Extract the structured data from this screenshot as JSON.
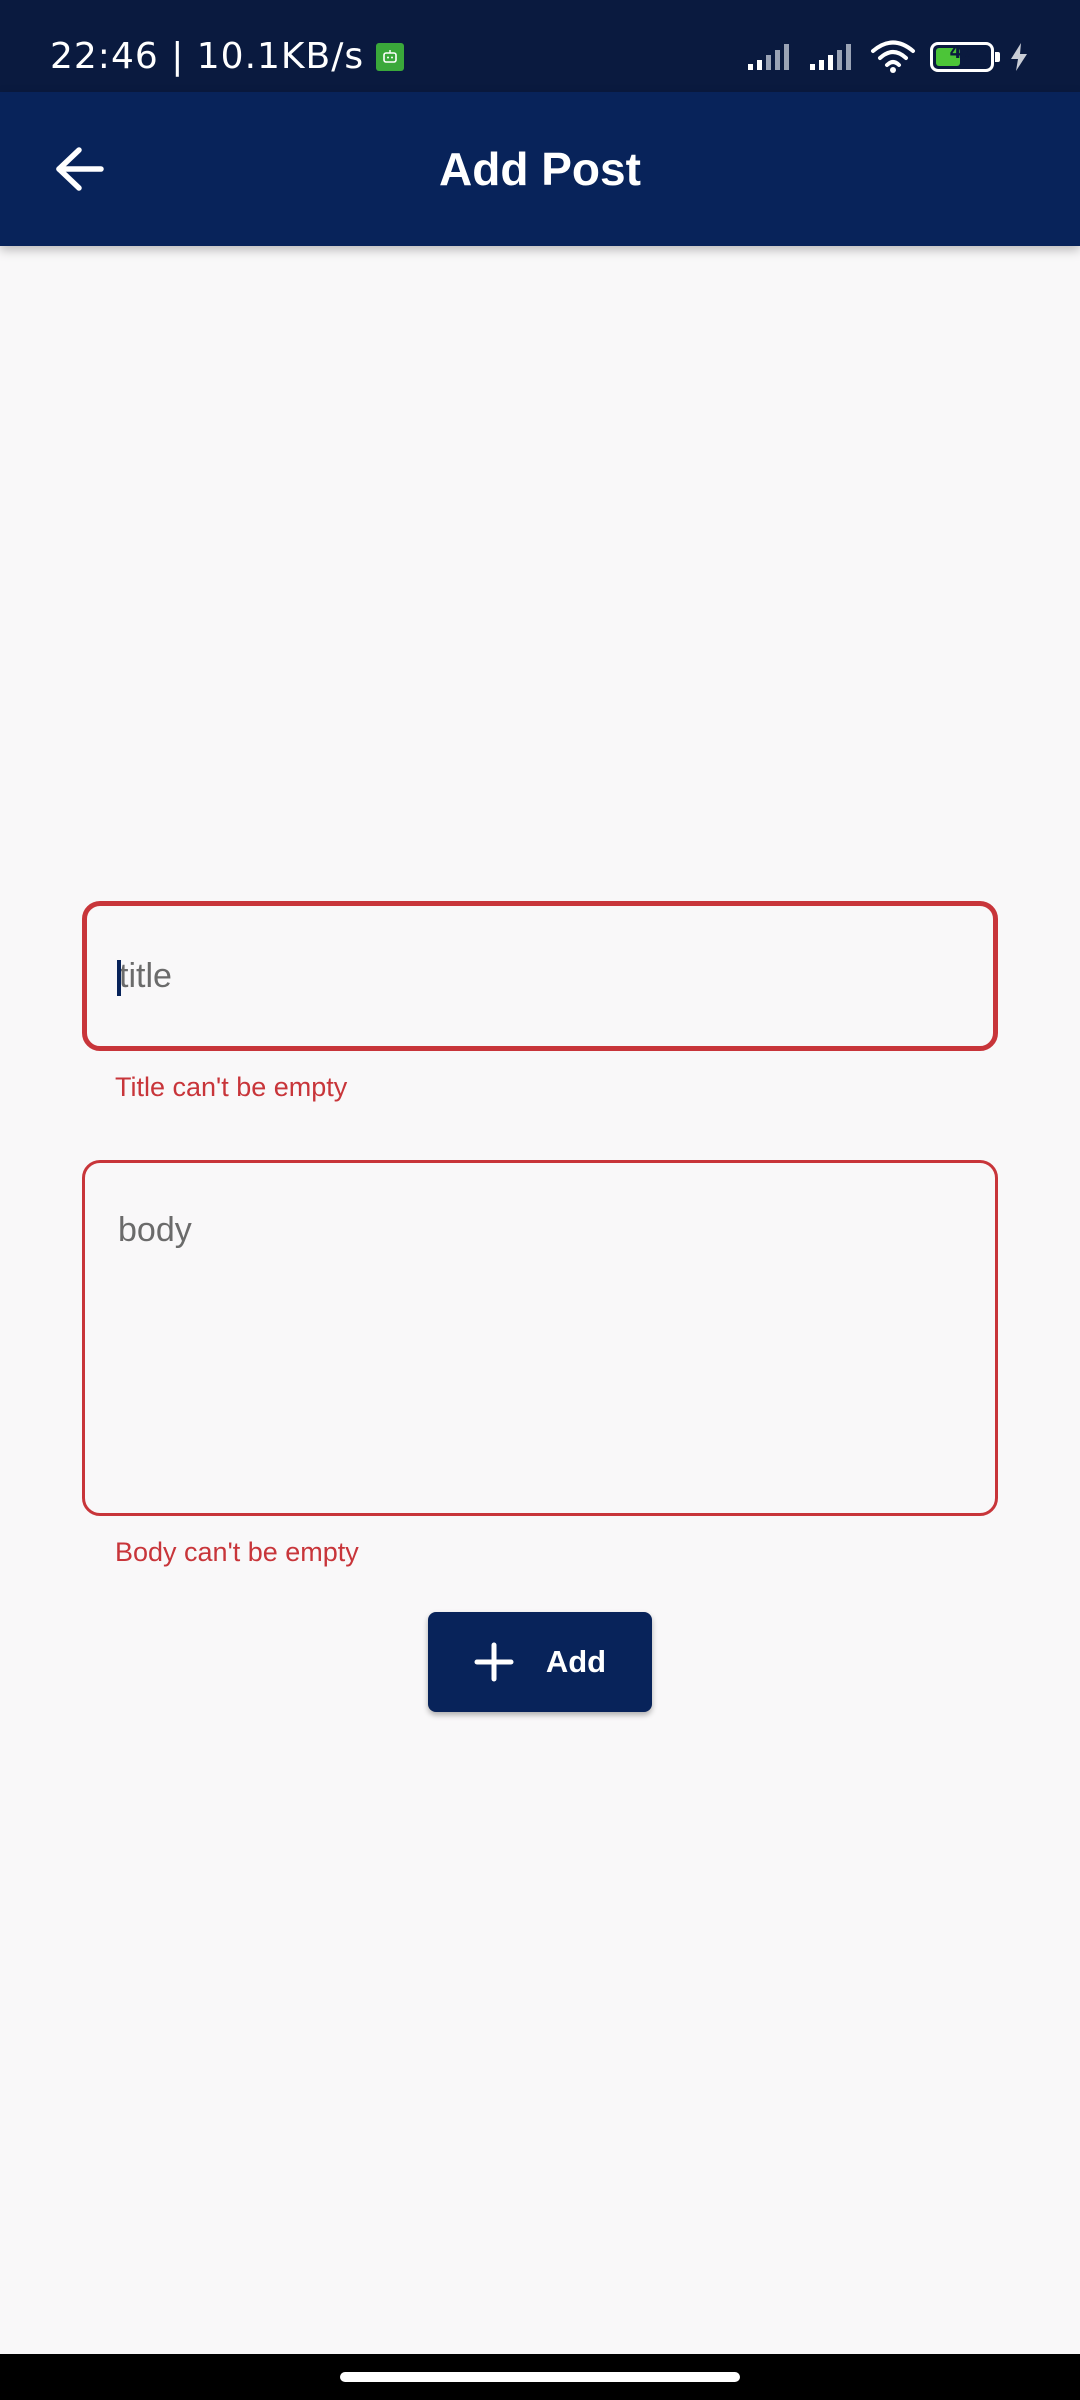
{
  "status_bar": {
    "time_speed": "22:46 | 10.1KB/s",
    "battery_level": "47",
    "icons": [
      "robot-icon",
      "signal-icon",
      "signal-icon",
      "wifi-icon",
      "battery-icon",
      "charging-icon"
    ]
  },
  "app_bar": {
    "title": "Add Post",
    "back_icon": "arrow-left-icon"
  },
  "form": {
    "title_placeholder": "title",
    "title_error": "Title can't be empty",
    "body_placeholder": "body",
    "body_error": "Body can't be empty",
    "add_label": "Add",
    "add_icon": "plus-icon"
  },
  "colors": {
    "app_bar": "#08235a",
    "status_bar": "#0a1a3f",
    "error": "#c8353a",
    "background": "#f9f8f9"
  }
}
